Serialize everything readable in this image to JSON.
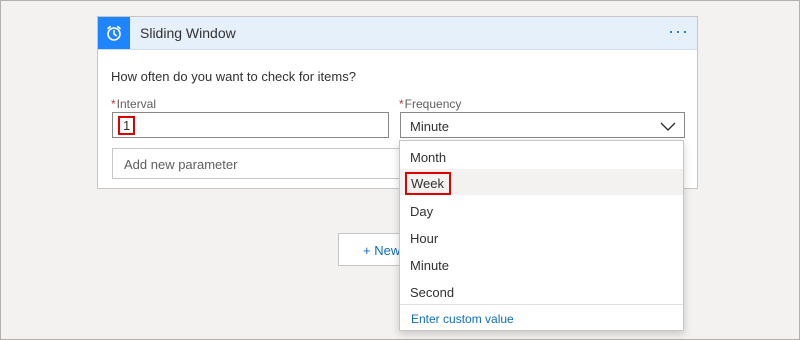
{
  "trigger": {
    "title": "Sliding Window",
    "icon": "alarm-clock-icon",
    "more_label": "···",
    "question": "How often do you want to check for items?"
  },
  "fields": {
    "required_mark": "*",
    "interval_label": "Interval",
    "interval_value": "1",
    "frequency_label": "Frequency",
    "frequency_value": "Minute"
  },
  "add_parameter": {
    "placeholder": "Add new parameter"
  },
  "new_step": {
    "label": "+ New"
  },
  "dropdown": {
    "options": [
      "Month",
      "Week",
      "Day",
      "Hour",
      "Minute",
      "Second"
    ],
    "highlighted": "Week",
    "custom_value_label": "Enter custom value"
  },
  "colors": {
    "accent": "#1f85ff",
    "header_bg": "#e6f0fb",
    "link": "#0f6cbd",
    "required": "#c4314b",
    "highlight_border": "#e00000"
  }
}
